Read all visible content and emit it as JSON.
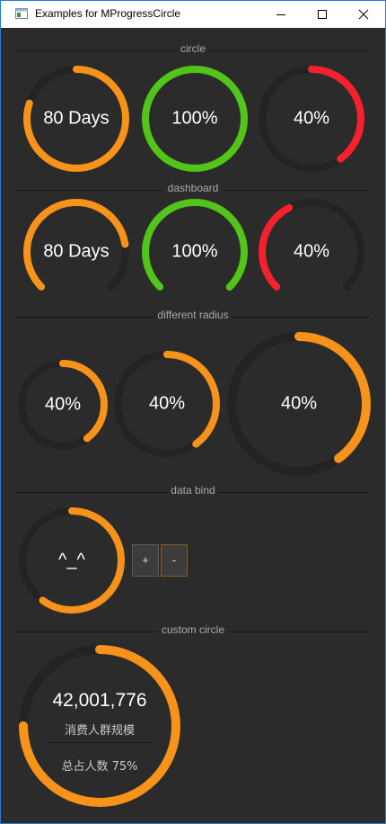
{
  "window": {
    "title": "Examples for MProgressCircle"
  },
  "colors": {
    "orange": "#f7931a",
    "green": "#52c41a",
    "red": "#f5222d",
    "track": "#232323"
  },
  "sections": {
    "circle": "circle",
    "dashboard": "dashboard",
    "different_radius": "different radius",
    "data_bind": "data bind",
    "custom_circle": "custom circle"
  },
  "circle": [
    {
      "label": "80 Days",
      "percent": 80,
      "color": "orange"
    },
    {
      "label": "100%",
      "percent": 100,
      "color": "green"
    },
    {
      "label": "40%",
      "percent": 40,
      "color": "red"
    }
  ],
  "dashboard": [
    {
      "label": "80 Days",
      "percent": 80,
      "color": "orange"
    },
    {
      "label": "100%",
      "percent": 100,
      "color": "green"
    },
    {
      "label": "40%",
      "percent": 40,
      "color": "red"
    }
  ],
  "different_radius": [
    {
      "label": "40%",
      "percent": 40,
      "color": "orange"
    },
    {
      "label": "40%",
      "percent": 40,
      "color": "orange"
    },
    {
      "label": "40%",
      "percent": 40,
      "color": "orange"
    }
  ],
  "data_bind": {
    "label": "^_^",
    "percent": 60,
    "color": "orange",
    "plus_label": "+",
    "minus_label": "-"
  },
  "custom_circle": {
    "value": "42,001,776",
    "caption": "消费人群规模",
    "ratio_text": "总占人数 75%",
    "percent": 75,
    "color": "orange"
  }
}
